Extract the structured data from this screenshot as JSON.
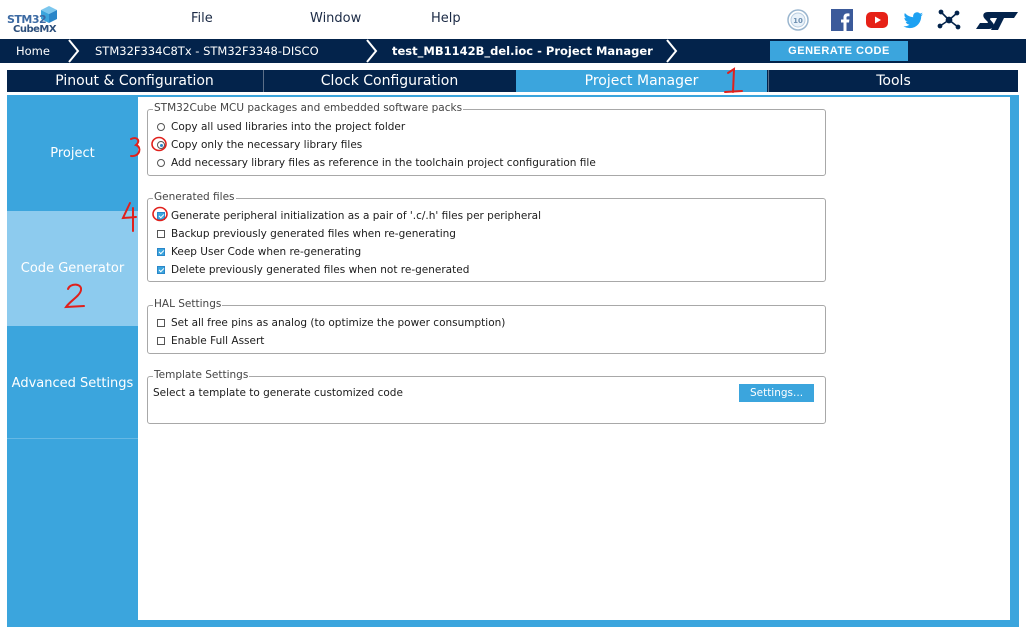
{
  "app": {
    "logo_line1": "STM32",
    "logo_line2": "CubeMX"
  },
  "menu": {
    "file": "File",
    "window": "Window",
    "help": "Help"
  },
  "top_icons": [
    "anniversary-10-icon",
    "facebook-icon",
    "youtube-icon",
    "twitter-icon",
    "network-icon",
    "st-logo-icon"
  ],
  "breadcrumb": {
    "home": "Home",
    "mcu": "STM32F334C8Tx  -  STM32F3348-DISCO",
    "project": "test_MB1142B_del.ioc - Project Manager"
  },
  "generate_button": "GENERATE CODE",
  "tabs": {
    "pinout": "Pinout & Configuration",
    "clock": "Clock Configuration",
    "project_manager": "Project Manager",
    "tools": "Tools",
    "active": "Project Manager"
  },
  "sidebar": {
    "project": "Project",
    "code_generator": "Code Generator",
    "advanced": "Advanced Settings",
    "active": "Code Generator"
  },
  "packs": {
    "legend": "STM32Cube MCU packages and embedded software packs",
    "opt1": "Copy all used libraries into the project folder",
    "opt2": "Copy only the necessary library files",
    "opt3": "Add necessary library files as reference in the toolchain project configuration file",
    "selected": "Copy only the necessary library files"
  },
  "generated": {
    "legend": "Generated files",
    "opt1": "Generate peripheral initialization as a pair of '.c/.h' files per peripheral",
    "opt2": "Backup previously generated files when re-generating",
    "opt3": "Keep User Code when re-generating",
    "opt4": "Delete previously generated files when not re-generated",
    "checked": [
      true,
      false,
      true,
      true
    ]
  },
  "hal": {
    "legend": "HAL Settings",
    "opt1": "Set all free pins as analog (to optimize the power consumption)",
    "opt2": "Enable Full Assert",
    "checked": [
      false,
      false
    ]
  },
  "template": {
    "legend": "Template Settings",
    "text": "Select a template to generate customized code",
    "button": "Settings..."
  },
  "annotations": {
    "a1": "1",
    "a2": "2",
    "a3": "3",
    "a4": "4",
    "color": "#e0201c"
  },
  "colors": {
    "navy": "#03234b",
    "accent": "#3ba5dd",
    "sidebar_active": "#8dcbee"
  }
}
